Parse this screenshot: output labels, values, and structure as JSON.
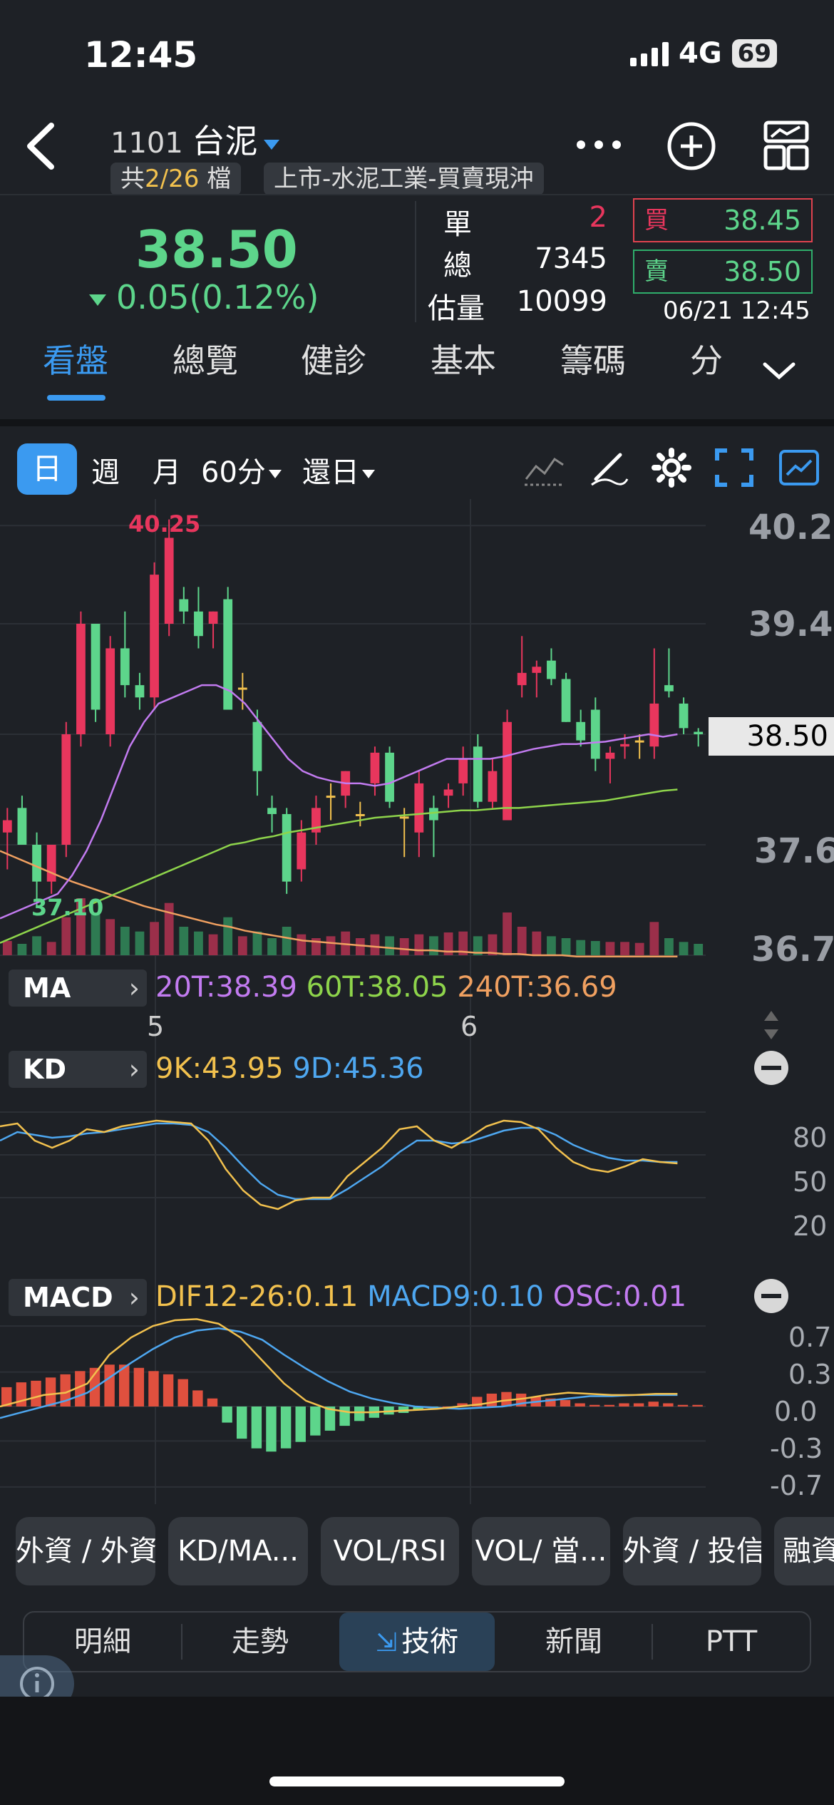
{
  "status_bar": {
    "time": "12:45",
    "network": "4G",
    "battery": "69"
  },
  "header": {
    "stock_code": "1101",
    "stock_name": "台泥",
    "count_prefix": "共",
    "count_value": "2/26",
    "count_suffix": "檔",
    "market_info": "上市-水泥工業-買賣現沖"
  },
  "quote": {
    "price": "38.50",
    "change": "0.05(0.12%)",
    "single_label": "單",
    "single_value": "2",
    "total_label": "總",
    "total_value": "7345",
    "est_label": "估量",
    "est_value": "10099",
    "buy_label": "買",
    "buy_price": "38.45",
    "sell_label": "賣",
    "sell_price": "38.50",
    "timestamp": "06/21 12:45"
  },
  "tabs": [
    "看盤",
    "總覽",
    "健診",
    "基本",
    "籌碼",
    "分"
  ],
  "period": {
    "day": "日",
    "week": "週",
    "month": "月",
    "minute": "60分",
    "restore": "還日"
  },
  "chart_labels": {
    "high": "40.25",
    "low": "37.10",
    "last": "38.50",
    "y_ticks": [
      "40.2",
      "39.4",
      "37.6",
      "36.7"
    ],
    "x_ticks": [
      "5",
      "6"
    ],
    "kd_ticks": [
      "80",
      "50",
      "20"
    ],
    "macd_ticks": [
      "0.7",
      "0.3",
      "0.0",
      "-0.3",
      "-0.7"
    ]
  },
  "indicators": {
    "ma": {
      "label": "MA",
      "ma20": "20T:38.39",
      "ma60": "60T:38.05",
      "ma240": "240T:36.69"
    },
    "kd": {
      "label": "KD",
      "k": "9K:43.95",
      "d": "9D:45.36"
    },
    "macd": {
      "label": "MACD",
      "dif": "DIF12-26:0.11",
      "macd9": "MACD9:0.10",
      "osc": "OSC:0.01"
    }
  },
  "chart_data": {
    "type": "candlestick",
    "ylim": [
      36.7,
      40.3
    ],
    "candles": [
      {
        "o": 37.7,
        "h": 37.9,
        "l": 37.4,
        "c": 37.8
      },
      {
        "o": 37.9,
        "h": 38.0,
        "l": 37.6,
        "c": 37.6
      },
      {
        "o": 37.6,
        "h": 37.7,
        "l": 37.1,
        "c": 37.3
      },
      {
        "o": 37.3,
        "h": 37.6,
        "l": 37.2,
        "c": 37.6
      },
      {
        "o": 37.6,
        "h": 38.6,
        "l": 37.5,
        "c": 38.5
      },
      {
        "o": 38.5,
        "h": 39.5,
        "l": 38.4,
        "c": 39.4
      },
      {
        "o": 39.4,
        "h": 39.4,
        "l": 38.6,
        "c": 38.7
      },
      {
        "o": 38.5,
        "h": 39.3,
        "l": 38.4,
        "c": 39.2
      },
      {
        "o": 39.2,
        "h": 39.5,
        "l": 38.8,
        "c": 38.9
      },
      {
        "o": 38.9,
        "h": 39.0,
        "l": 38.7,
        "c": 38.8
      },
      {
        "o": 38.8,
        "h": 39.9,
        "l": 38.7,
        "c": 39.8
      },
      {
        "o": 39.4,
        "h": 40.25,
        "l": 39.3,
        "c": 40.1
      },
      {
        "o": 39.6,
        "h": 39.7,
        "l": 39.4,
        "c": 39.5
      },
      {
        "o": 39.5,
        "h": 39.7,
        "l": 39.2,
        "c": 39.3
      },
      {
        "o": 39.4,
        "h": 39.5,
        "l": 39.2,
        "c": 39.5
      },
      {
        "o": 39.6,
        "h": 39.7,
        "l": 38.7,
        "c": 38.7
      },
      {
        "o": 38.88,
        "h": 39.0,
        "l": 38.7,
        "c": 38.88
      },
      {
        "o": 38.6,
        "h": 38.7,
        "l": 38.0,
        "c": 38.2
      },
      {
        "o": 37.9,
        "h": 38.0,
        "l": 37.7,
        "c": 37.85
      },
      {
        "o": 37.85,
        "h": 37.9,
        "l": 37.2,
        "c": 37.3
      },
      {
        "o": 37.4,
        "h": 37.8,
        "l": 37.3,
        "c": 37.7
      },
      {
        "o": 37.7,
        "h": 38.0,
        "l": 37.6,
        "c": 37.9
      },
      {
        "o": 38.0,
        "h": 38.1,
        "l": 37.8,
        "c": 38.0
      },
      {
        "o": 38.0,
        "h": 38.2,
        "l": 37.9,
        "c": 38.2
      },
      {
        "o": 37.85,
        "h": 37.95,
        "l": 37.75,
        "c": 37.85
      },
      {
        "o": 38.1,
        "h": 38.4,
        "l": 38.0,
        "c": 38.35
      },
      {
        "o": 38.35,
        "h": 38.4,
        "l": 37.9,
        "c": 37.95
      },
      {
        "o": 37.83,
        "h": 37.9,
        "l": 37.5,
        "c": 37.83
      },
      {
        "o": 37.7,
        "h": 38.2,
        "l": 37.5,
        "c": 38.1
      },
      {
        "o": 37.9,
        "h": 38.0,
        "l": 37.5,
        "c": 37.8
      },
      {
        "o": 38.0,
        "h": 38.1,
        "l": 37.9,
        "c": 38.05
      },
      {
        "o": 38.1,
        "h": 38.4,
        "l": 38.0,
        "c": 38.3
      },
      {
        "o": 38.4,
        "h": 38.5,
        "l": 37.9,
        "c": 37.95
      },
      {
        "o": 37.95,
        "h": 38.3,
        "l": 37.9,
        "c": 38.2
      },
      {
        "o": 37.8,
        "h": 38.7,
        "l": 37.8,
        "c": 38.6
      },
      {
        "o": 38.9,
        "h": 39.3,
        "l": 38.8,
        "c": 39.0
      },
      {
        "o": 39.0,
        "h": 39.1,
        "l": 38.8,
        "c": 39.05
      },
      {
        "o": 39.1,
        "h": 39.2,
        "l": 38.9,
        "c": 38.95
      },
      {
        "o": 38.95,
        "h": 39.0,
        "l": 38.6,
        "c": 38.6
      },
      {
        "o": 38.6,
        "h": 38.7,
        "l": 38.4,
        "c": 38.45
      },
      {
        "o": 38.7,
        "h": 38.8,
        "l": 38.2,
        "c": 38.3
      },
      {
        "o": 38.3,
        "h": 38.4,
        "l": 38.1,
        "c": 38.35
      },
      {
        "o": 38.4,
        "h": 38.5,
        "l": 38.3,
        "c": 38.42
      },
      {
        "o": 38.45,
        "h": 38.5,
        "l": 38.3,
        "c": 38.45
      },
      {
        "o": 38.4,
        "h": 39.2,
        "l": 38.3,
        "c": 38.75
      },
      {
        "o": 38.9,
        "h": 39.2,
        "l": 38.8,
        "c": 38.85
      },
      {
        "o": 38.75,
        "h": 38.8,
        "l": 38.5,
        "c": 38.55
      },
      {
        "o": 38.52,
        "h": 38.55,
        "l": 38.4,
        "c": 38.5
      }
    ],
    "ma20": [
      37.0,
      37.05,
      37.1,
      37.15,
      37.2,
      37.35,
      37.55,
      37.8,
      38.1,
      38.4,
      38.6,
      38.75,
      38.8,
      38.85,
      38.9,
      38.9,
      38.85,
      38.75,
      38.6,
      38.45,
      38.3,
      38.2,
      38.15,
      38.12,
      38.1,
      38.1,
      38.08,
      38.1,
      38.15,
      38.2,
      38.25,
      38.3,
      38.3,
      38.3,
      38.3,
      38.32,
      38.35,
      38.38,
      38.4,
      38.42,
      38.42,
      38.43,
      38.44,
      38.46,
      38.48,
      38.5,
      38.48,
      38.5
    ],
    "ma60": [
      36.8,
      36.85,
      36.9,
      36.95,
      37.0,
      37.05,
      37.1,
      37.15,
      37.2,
      37.25,
      37.3,
      37.35,
      37.4,
      37.45,
      37.5,
      37.55,
      37.6,
      37.62,
      37.65,
      37.67,
      37.7,
      37.72,
      37.74,
      37.76,
      37.78,
      37.8,
      37.82,
      37.83,
      37.84,
      37.85,
      37.86,
      37.87,
      37.88,
      37.88,
      37.89,
      37.9,
      37.9,
      37.91,
      37.92,
      37.93,
      37.94,
      37.95,
      37.96,
      37.98,
      38.0,
      38.02,
      38.04,
      38.05
    ],
    "ma240": [
      37.55,
      37.5,
      37.45,
      37.4,
      37.35,
      37.3,
      37.26,
      37.22,
      37.18,
      37.14,
      37.1,
      37.07,
      37.04,
      37.01,
      36.98,
      36.95,
      36.93,
      36.9,
      36.88,
      36.86,
      36.84,
      36.82,
      36.81,
      36.8,
      36.79,
      36.78,
      36.77,
      36.76,
      36.75,
      36.74,
      36.74,
      36.73,
      36.73,
      36.72,
      36.72,
      36.71,
      36.71,
      36.7,
      36.7,
      36.7,
      36.69,
      36.69,
      36.69,
      36.69,
      36.69,
      36.69,
      36.69,
      36.69
    ],
    "volume": [
      15,
      12,
      20,
      14,
      40,
      60,
      45,
      38,
      30,
      25,
      35,
      55,
      30,
      25,
      22,
      40,
      20,
      25,
      18,
      30,
      22,
      18,
      20,
      25,
      18,
      22,
      20,
      18,
      22,
      20,
      24,
      25,
      20,
      22,
      45,
      30,
      25,
      20,
      18,
      16,
      15,
      14,
      14,
      13,
      35,
      18,
      14,
      12
    ],
    "kd_k": [
      70,
      72,
      60,
      55,
      60,
      68,
      66,
      70,
      72,
      74,
      73,
      72,
      60,
      40,
      25,
      15,
      12,
      18,
      20,
      20,
      35,
      45,
      55,
      68,
      70,
      60,
      55,
      62,
      70,
      74,
      73,
      68,
      55,
      45,
      40,
      38,
      42,
      47,
      45,
      44
    ],
    "kd_d": [
      60,
      66,
      64,
      62,
      63,
      65,
      66,
      68,
      70,
      72,
      72,
      71,
      66,
      55,
      42,
      30,
      22,
      19,
      19,
      19,
      26,
      34,
      42,
      52,
      60,
      60,
      58,
      59,
      63,
      67,
      69,
      69,
      64,
      57,
      52,
      48,
      46,
      46,
      45,
      45
    ],
    "macd_dif": [
      0.0,
      0.05,
      0.1,
      0.12,
      0.2,
      0.45,
      0.6,
      0.7,
      0.75,
      0.76,
      0.72,
      0.6,
      0.4,
      0.2,
      0.05,
      -0.02,
      -0.05,
      -0.05,
      -0.04,
      -0.03,
      -0.02,
      0.0,
      0.02,
      0.05,
      0.07,
      0.1,
      0.12,
      0.11,
      0.1,
      0.1,
      0.11,
      0.11
    ],
    "macd_signal": [
      -0.1,
      -0.05,
      0.0,
      0.05,
      0.12,
      0.25,
      0.38,
      0.5,
      0.6,
      0.66,
      0.68,
      0.65,
      0.58,
      0.45,
      0.33,
      0.22,
      0.13,
      0.07,
      0.03,
      0.0,
      -0.01,
      -0.02,
      -0.01,
      0.0,
      0.03,
      0.05,
      0.07,
      0.09,
      0.09,
      0.1,
      0.1,
      0.1
    ],
    "macd_osc": [
      0.12,
      0.15,
      0.16,
      0.18,
      0.2,
      0.22,
      0.24,
      0.26,
      0.26,
      0.24,
      0.22,
      0.2,
      0.17,
      0.1,
      0.05,
      -0.1,
      -0.2,
      -0.26,
      -0.28,
      -0.26,
      -0.22,
      -0.18,
      -0.15,
      -0.12,
      -0.09,
      -0.07,
      -0.05,
      -0.04,
      -0.02,
      -0.01,
      0.0,
      0.02,
      0.06,
      0.08,
      0.09,
      0.08,
      0.06,
      0.05,
      0.04,
      0.02,
      0.01,
      0.01,
      0.02,
      0.02,
      0.03,
      0.02,
      0.01,
      0.01
    ]
  },
  "quick_buttons": [
    "外資 / 外資",
    "KD/MA...",
    "VOL/RSI",
    "VOL/ 當...",
    "外資 / 投信",
    "融資"
  ],
  "bottom_tabs": [
    "明細",
    "走勢",
    "技術",
    "新聞",
    "PTT"
  ],
  "colors": {
    "up": "#e8365d",
    "down": "#5dd58b",
    "accent": "#3b9af0",
    "ma20": "#c27bf0",
    "ma60": "#8ed44b",
    "ma240": "#f0a060",
    "k": "#f2c14e",
    "d": "#4ea7f0"
  }
}
